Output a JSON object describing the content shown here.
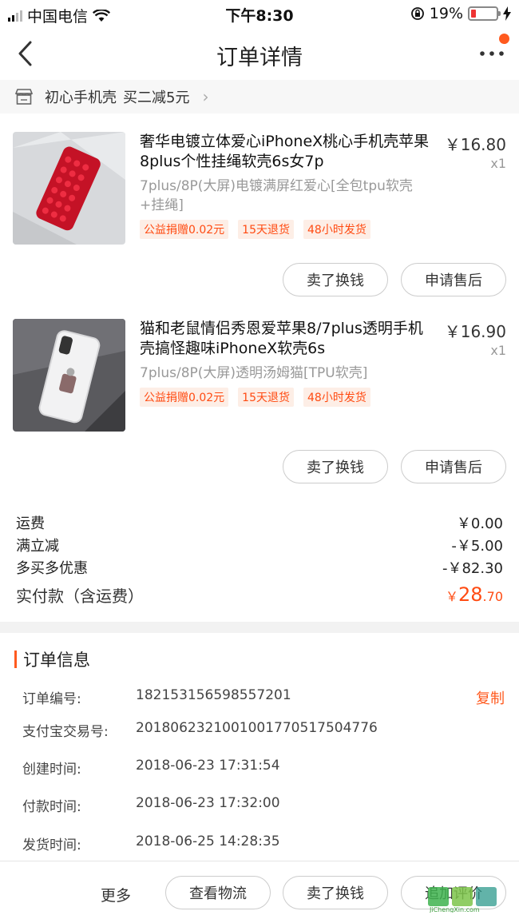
{
  "status_bar": {
    "carrier": "中国电信",
    "time": "下午8:30",
    "battery_percent": "19%",
    "battery_level": 0.19,
    "icons": [
      "signal-icon",
      "wifi-icon",
      "rotation-lock-icon",
      "battery-icon",
      "charging-icon"
    ]
  },
  "nav": {
    "title": "订单详情",
    "back_icon": "chevron-left-icon",
    "more_icon": "more-dots-icon",
    "accent": "#ff5a1f"
  },
  "store": {
    "name": "初心手机壳",
    "promo": "买二减5元",
    "icon": "store-icon"
  },
  "products": [
    {
      "title": "奢华电镀立体爱心iPhoneX桃心手机壳苹果8plus个性挂绳软壳6s女7p",
      "price": "￥16.80",
      "qty": "x1",
      "spec": "7plus/8P(大屏)电镀满屏红爱心[全包tpu软壳+挂绳]",
      "tags": [
        "公益捐赠0.02元",
        "15天退货",
        "48小时发货"
      ],
      "btn_sell": "卖了换钱",
      "btn_after_sale": "申请售后"
    },
    {
      "title": "猫和老鼠情侣秀恩爱苹果8/7plus透明手机壳搞怪趣味iPhoneX软壳6s",
      "price": "￥16.90",
      "qty": "x1",
      "spec": "7plus/8P(大屏)透明汤姆猫[TPU软壳]",
      "tags": [
        "公益捐赠0.02元",
        "15天退货",
        "48小时发货"
      ],
      "btn_sell": "卖了换钱",
      "btn_after_sale": "申请售后"
    }
  ],
  "summary": {
    "shipping_label": "运费",
    "shipping_value": "￥0.00",
    "discount_label": "满立减",
    "discount_value": "-￥5.00",
    "multi_label": "多买多优惠",
    "multi_value": "-￥82.30",
    "total_label": "实付款（含运费）",
    "total_currency": "￥",
    "total_int": "28",
    "total_dec": ".70",
    "total_color": "#ff4b12"
  },
  "order_info": {
    "title": "订单信息",
    "rows": [
      {
        "label": "订单编号:",
        "value": "182153156598557201"
      },
      {
        "label": "支付宝交易号:",
        "value": "2018062321001001770517504776"
      },
      {
        "label": "创建时间:",
        "value": "2018-06-23 17:31:54"
      },
      {
        "label": "付款时间:",
        "value": "2018-06-23 17:32:00"
      },
      {
        "label": "发货时间:",
        "value": "2018-06-25 14:28:35"
      }
    ],
    "copy_label": "复制"
  },
  "bottom_bar": {
    "more": "更多",
    "view_logistics": "查看物流",
    "sell": "卖了换钱",
    "review": "追加评价"
  },
  "watermark": {
    "text": "JiChengXin.com"
  }
}
